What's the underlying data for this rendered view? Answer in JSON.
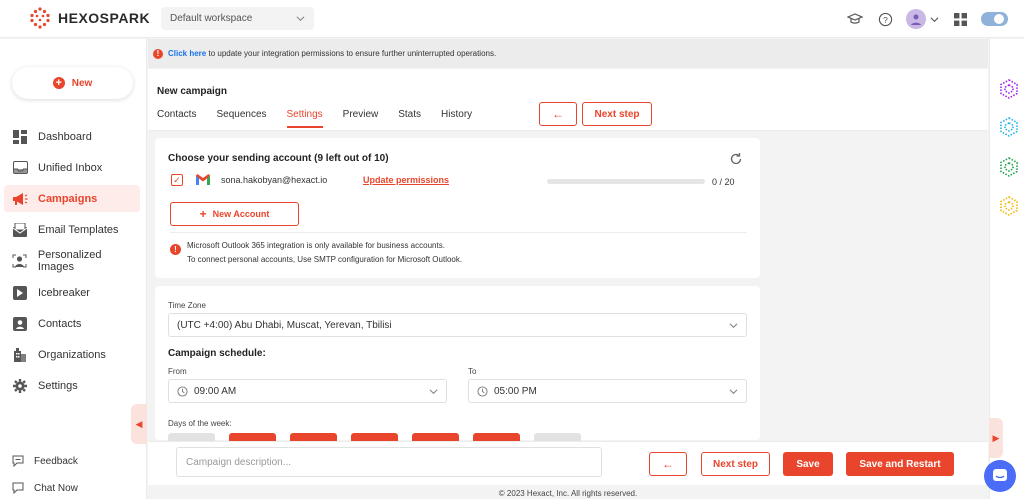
{
  "brand": {
    "name": "HEXOSPARK"
  },
  "workspace": {
    "selected": "Default workspace"
  },
  "sidebar": {
    "new_label": "New",
    "items": [
      {
        "label": "Dashboard",
        "icon": "dashboard-icon"
      },
      {
        "label": "Unified Inbox",
        "icon": "inbox-icon"
      },
      {
        "label": "Campaigns",
        "icon": "megaphone-icon",
        "active": true
      },
      {
        "label": "Email Templates",
        "icon": "template-icon"
      },
      {
        "label": "Personalized Images",
        "icon": "image-person-icon"
      },
      {
        "label": "Icebreaker",
        "icon": "icebreaker-icon"
      },
      {
        "label": "Contacts",
        "icon": "contacts-icon"
      },
      {
        "label": "Organizations",
        "icon": "organization-icon"
      },
      {
        "label": "Settings",
        "icon": "gear-icon"
      }
    ],
    "footer": [
      {
        "label": "Feedback",
        "icon": "feedback-icon"
      },
      {
        "label": "Chat Now",
        "icon": "chat-icon"
      }
    ]
  },
  "banner": {
    "link": "Click here",
    "text": " to update your integration permissions to ensure further uninterrupted operations."
  },
  "campaign": {
    "title": "New campaign",
    "tabs": [
      "Contacts",
      "Sequences",
      "Settings",
      "Preview",
      "Stats",
      "History"
    ],
    "active_tab": "Settings",
    "back_label": "←",
    "next_label": "Next step"
  },
  "sending": {
    "title": "Choose your sending account (9 left out of 10)",
    "account_email": "sona.hakobyan@hexact.io",
    "update_label": "Update permissions",
    "quota": "0 / 20",
    "progress": 0,
    "new_account_label": "New Account",
    "info_line1": "Microsoft Outlook 365 integration is only available for business accounts.",
    "info_line2": "To connect personal accounts, Use SMTP configuration for Microsoft Outlook."
  },
  "schedule": {
    "timezone_label": "Time Zone",
    "timezone_value": "(UTC +4:00) Abu Dhabi, Muscat, Yerevan, Tbilisi",
    "schedule_title": "Campaign schedule:",
    "from_label": "From",
    "from_value": "09:00 AM",
    "to_label": "To",
    "to_value": "05:00 PM",
    "days_label": "Days of the week:",
    "days": [
      {
        "on": false
      },
      {
        "on": true
      },
      {
        "on": true
      },
      {
        "on": true
      },
      {
        "on": true
      },
      {
        "on": true
      },
      {
        "on": false
      }
    ]
  },
  "bottom": {
    "description_placeholder": "Campaign description...",
    "back_label": "←",
    "next_label": "Next step",
    "save_label": "Save",
    "save_restart_label": "Save and Restart"
  },
  "footer": {
    "copyright": "© 2023 Hexact, Inc. All rights reserved."
  },
  "colors": {
    "accent": "#e8452c",
    "link": "#1a73e8",
    "chat": "#4a6cf7"
  }
}
